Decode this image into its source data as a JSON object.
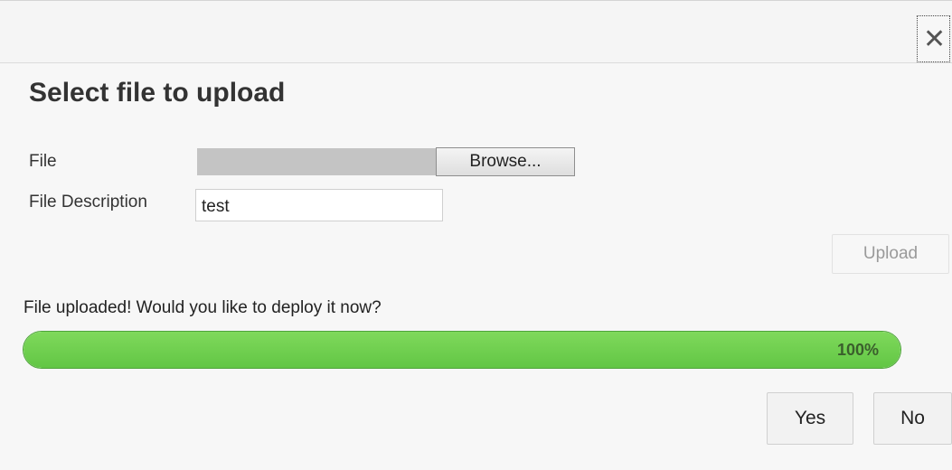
{
  "dialog": {
    "close_glyph": "✕",
    "title": "Select file to upload"
  },
  "form": {
    "file_label": "File",
    "browse_label": "Browse...",
    "description_label": "File Description",
    "description_value": "test",
    "upload_label": "Upload"
  },
  "status": {
    "message": "File uploaded! Would you like to deploy it now?",
    "progress_percent": 100,
    "progress_text": "100%",
    "progress_color": "#6cc94e"
  },
  "actions": {
    "yes_label": "Yes",
    "no_label": "No"
  }
}
